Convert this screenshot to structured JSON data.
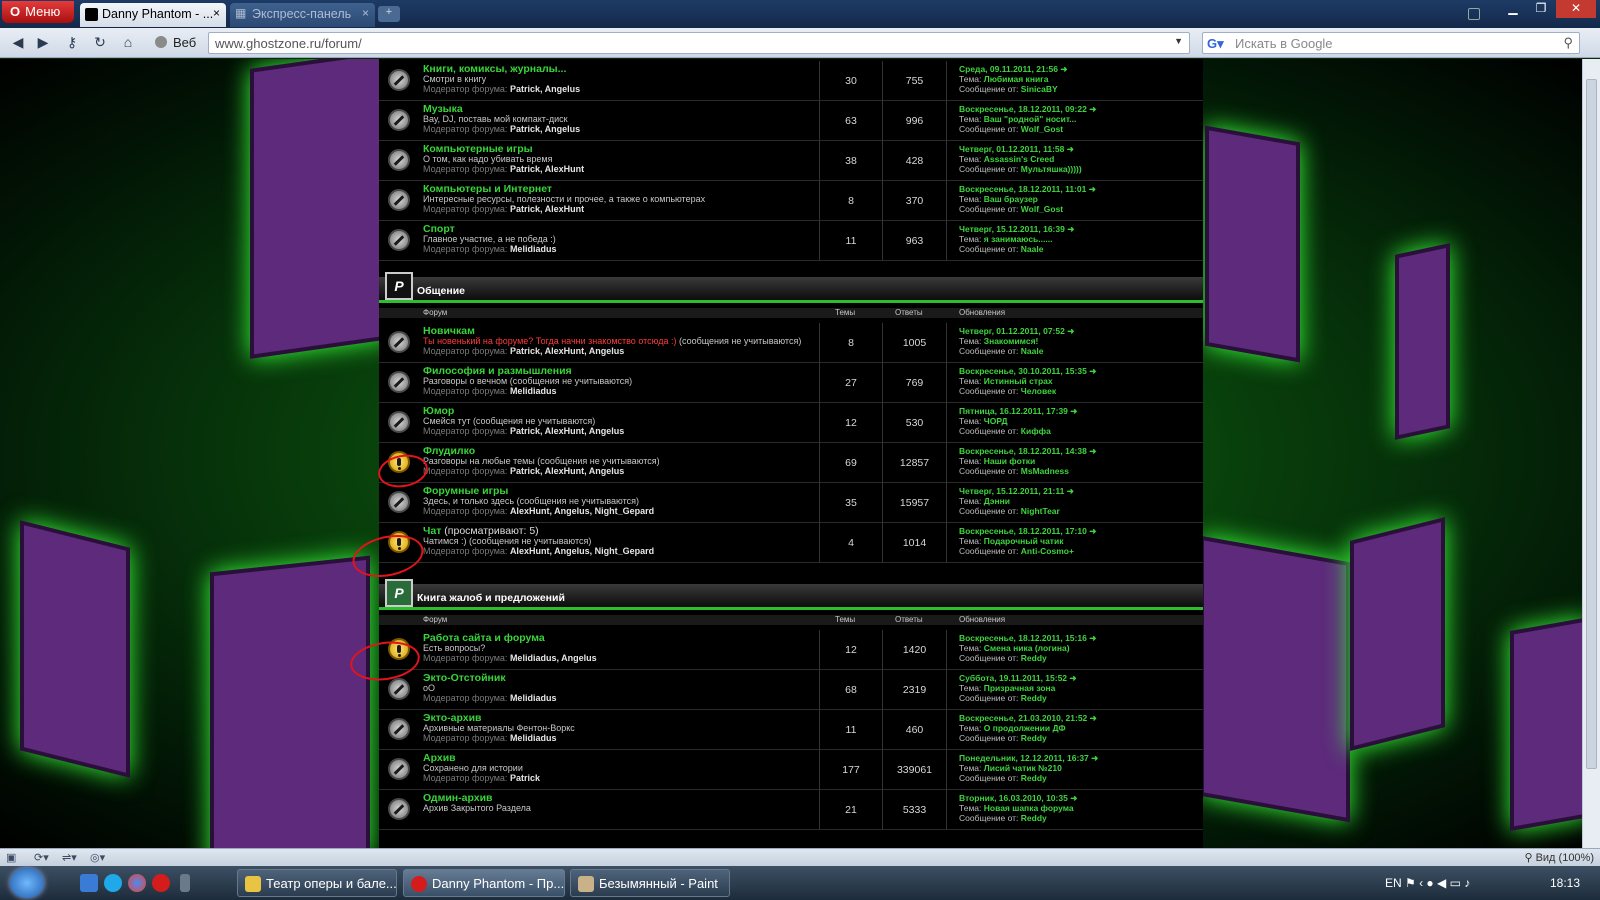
{
  "browser": {
    "menu_label": "Меню",
    "tabs": [
      {
        "label": "Danny Phantom - ...",
        "close": "×"
      },
      {
        "label": "Экспресс-панель",
        "close": "×"
      }
    ],
    "web_label": "Веб",
    "url": "www.ghostzone.ru/forum/",
    "search_placeholder": "Искать в Google",
    "zoom_label": "Вид (100%)"
  },
  "forum": {
    "rows_top": [
      {
        "title": "Книги, комиксы, журналы...",
        "desc": "Смотри в книгу",
        "mods": "Patrick, Angelus",
        "topics": "30",
        "replies": "755",
        "date": "Среда, 09.11.2011, 21:56",
        "topic": "Любимая книга",
        "author": "SinicaBY",
        "new": false
      },
      {
        "title": "Музыка",
        "desc": "Вау, DJ, поставь мой компакт-диск",
        "mods": "Patrick, Angelus",
        "topics": "63",
        "replies": "996",
        "date": "Воскресенье, 18.12.2011, 09:22",
        "topic": "Ваш \"родной\" носит...",
        "author": "Wolf_Gost",
        "new": false
      },
      {
        "title": "Компьютерные игры",
        "desc": "О том, как надо убивать время",
        "mods": "Patrick, AlexHunt",
        "topics": "38",
        "replies": "428",
        "date": "Четверг, 01.12.2011, 11:58",
        "topic": "Assassin's Creed",
        "author": "Мультяшка)))))",
        "new": false
      },
      {
        "title": "Компьютеры и Интернет",
        "desc": "Интересные ресурсы, полезности и прочее, а также о компьютерах",
        "mods": "Patrick, AlexHunt",
        "topics": "8",
        "replies": "370",
        "date": "Воскресенье, 18.12.2011, 11:01",
        "topic": "Ваш браузер",
        "author": "Wolf_Gost",
        "new": false
      },
      {
        "title": "Спорт",
        "desc": "Главное участие, а не победа :)",
        "mods": "Melidiadus",
        "topics": "11",
        "replies": "963",
        "date": "Четверг, 15.12.2011, 16:39",
        "topic": "я занимаюсь......",
        "author": "Naale",
        "new": false
      }
    ],
    "cat1": {
      "title": "Общение",
      "col_forum": "Форум",
      "col_topics": "Темы",
      "col_replies": "Ответы",
      "col_updates": "Обновления"
    },
    "rows_cat1": [
      {
        "title": "Новичкам",
        "desc_red": "Ты новенький на форуме? Тогда начни знакомство отсюда :)",
        "desc": "(сообщения не учитываются)",
        "mods": "Patrick, AlexHunt, Angelus",
        "topics": "8",
        "replies": "1005",
        "date": "Четверг, 01.12.2011, 07:52",
        "topic": "Знакомимся!",
        "author": "Naale",
        "new": false
      },
      {
        "title": "Философия и размышления",
        "desc": "Разговоры о вечном (сообщения не учитываются)",
        "mods": "Melidiadus",
        "topics": "27",
        "replies": "769",
        "date": "Воскресенье, 30.10.2011, 15:35",
        "topic": "Истинный страх",
        "author": "Человек",
        "new": false
      },
      {
        "title": "Юмор",
        "desc": "Смейся тут (сообщения не учитываются)",
        "mods": "Patrick, AlexHunt, Angelus",
        "topics": "12",
        "replies": "530",
        "date": "Пятница, 16.12.2011, 17:39",
        "topic": "ЧОРД",
        "author": "Киффа",
        "new": false
      },
      {
        "title": "Флудилко",
        "desc": "Разговоры на любые темы (сообщения не учитываются)",
        "mods": "Patrick, AlexHunt, Angelus",
        "topics": "69",
        "replies": "12857",
        "date": "Воскресенье, 18.12.2011, 14:38",
        "topic": "Наши фотки",
        "author": "MsMadness",
        "new": true
      },
      {
        "title": "Форумные игры",
        "desc": "Здесь, и только здесь (сообщения не учитываются)",
        "mods": "AlexHunt, Angelus, Night_Gepard",
        "topics": "35",
        "replies": "15957",
        "date": "Четверг, 15.12.2011, 21:11",
        "topic": "Дэнни",
        "author": "NightTear",
        "new": false
      },
      {
        "title": "Чат",
        "title_extra": "(просматривают: 5)",
        "desc": "Чатимся :) (сообщения не учитываются)",
        "mods": "AlexHunt, Angelus, Night_Gepard",
        "topics": "4",
        "replies": "1014",
        "date": "Воскресенье, 18.12.2011, 17:10",
        "topic": "Подарочный чатик",
        "author": "Anti-Cosmo+",
        "new": true
      }
    ],
    "cat2": {
      "title": "Книга жалоб и предложений",
      "col_forum": "Форум",
      "col_topics": "Темы",
      "col_replies": "Ответы",
      "col_updates": "Обновления"
    },
    "rows_cat2": [
      {
        "title": "Работа сайта и форума",
        "desc": "Есть вопросы?",
        "mods": "Melidiadus, Angelus",
        "topics": "12",
        "replies": "1420",
        "date": "Воскресенье, 18.12.2011, 15:16",
        "topic": "Смена ника (логина)",
        "author": "Reddy",
        "new": true
      },
      {
        "title": "Экто-Отстойник",
        "desc": "оО",
        "mods": "Melidiadus",
        "topics": "68",
        "replies": "2319",
        "date": "Суббота, 19.11.2011, 15:52",
        "topic": "Призрачная зона",
        "author": "Reddy",
        "new": false
      },
      {
        "title": "Экто-архив",
        "desc": "Архивные материалы Фентон-Воркс",
        "mods": "Melidiadus",
        "topics": "11",
        "replies": "460",
        "date": "Воскресенье, 21.03.2010, 21:52",
        "topic": "О продолжении ДФ",
        "author": "Reddy",
        "new": false
      },
      {
        "title": "Архив",
        "desc": "Сохранено для истории",
        "mods": "Patrick",
        "topics": "177",
        "replies": "339061",
        "date": "Понедельник, 12.12.2011, 16:37",
        "topic": "Лисий чатик №210",
        "author": "Reddy",
        "new": false
      },
      {
        "title": "Одмин-архив",
        "desc": "Архив Закрытого Раздела",
        "mods": "",
        "topics": "21",
        "replies": "5333",
        "date": "Вторник, 16.03.2010, 10:35",
        "topic": "Новая шапка форума",
        "author": "Reddy",
        "new": false
      }
    ],
    "labels": {
      "moderator": "Модератор форума:",
      "topic": "Тема:",
      "message_from": "Сообщение от:"
    }
  },
  "taskbar": {
    "tasks": [
      "Театр оперы и бале...",
      "Danny Phantom - Пр...",
      "Безымянный - Paint"
    ],
    "lang": "EN",
    "clock": "18:13"
  },
  "colors": {
    "accent_green": "#39d439",
    "brand_purple": "#5e2a7c",
    "annotation_red": "#e2141b"
  }
}
